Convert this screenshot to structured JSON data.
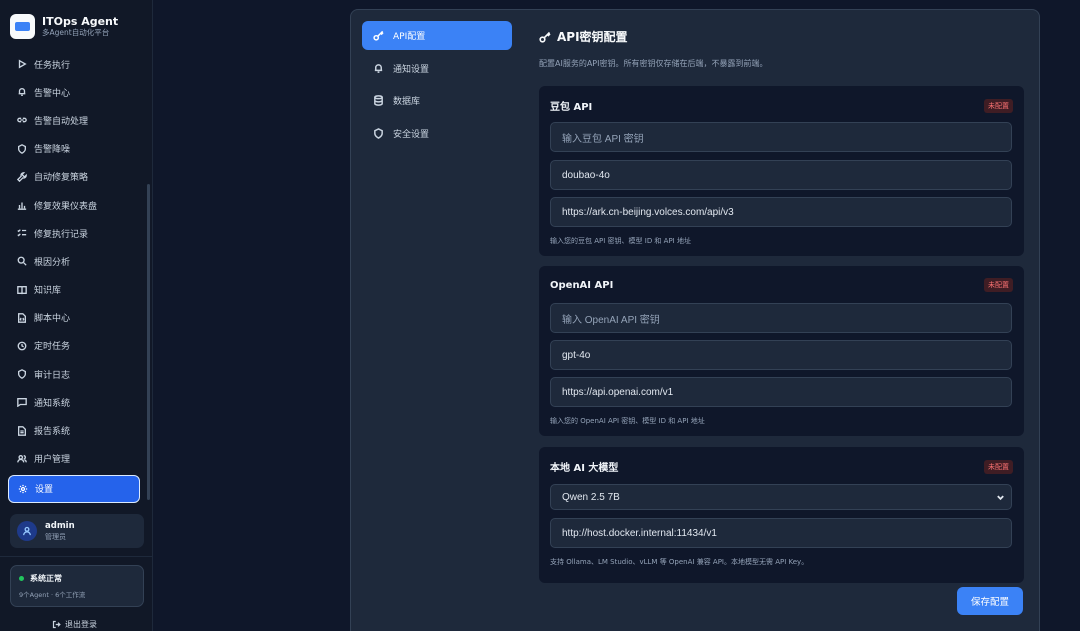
{
  "brand": {
    "name": "ITOps Agent",
    "subtitle": "多Agent自动化平台"
  },
  "sidebar": {
    "items": [
      {
        "label": "任务执行",
        "icon": "play-icon"
      },
      {
        "label": "告警中心",
        "icon": "bell-icon"
      },
      {
        "label": "告警自动处理",
        "icon": "link-icon"
      },
      {
        "label": "告警降噪",
        "icon": "shield-icon"
      },
      {
        "label": "自动修复策略",
        "icon": "wrench-icon"
      },
      {
        "label": "修复效果仪表盘",
        "icon": "bar-chart-icon"
      },
      {
        "label": "修复执行记录",
        "icon": "list-check-icon"
      },
      {
        "label": "根因分析",
        "icon": "search-icon"
      },
      {
        "label": "知识库",
        "icon": "book-icon"
      },
      {
        "label": "脚本中心",
        "icon": "file-code-icon"
      },
      {
        "label": "定时任务",
        "icon": "clock-icon"
      },
      {
        "label": "审计日志",
        "icon": "shield-icon"
      },
      {
        "label": "通知系统",
        "icon": "message-icon"
      },
      {
        "label": "报告系统",
        "icon": "file-text-icon"
      },
      {
        "label": "用户管理",
        "icon": "users-icon"
      },
      {
        "label": "设置",
        "icon": "gear-icon",
        "active": true
      }
    ]
  },
  "user": {
    "name": "admin",
    "role": "管理员"
  },
  "status": {
    "title": "系统正常",
    "detail": "9个Agent · 6个工作流"
  },
  "logout_label": "退出登录",
  "settings_nav": {
    "items": [
      {
        "label": "API配置",
        "icon": "key-icon",
        "active": true
      },
      {
        "label": "通知设置",
        "icon": "bell-icon"
      },
      {
        "label": "数据库",
        "icon": "database-icon"
      },
      {
        "label": "安全设置",
        "icon": "shield-icon"
      }
    ]
  },
  "content": {
    "title": "API密钥配置",
    "description": "配置AI服务的API密钥。所有密钥仅存储在后端，不暴露到前端。"
  },
  "providers": [
    {
      "name": "豆包 API",
      "badge": "未配置",
      "key_placeholder": "输入豆包 API 密钥",
      "model": "doubao-4o",
      "url": "https://ark.cn-beijing.volces.com/api/v3",
      "help": "输入您的豆包 API 密钥、模型 ID 和 API 地址"
    },
    {
      "name": "OpenAI API",
      "badge": "未配置",
      "key_placeholder": "输入 OpenAI API 密钥",
      "model": "gpt-4o",
      "url": "https://api.openai.com/v1",
      "help": "输入您的 OpenAI API 密钥、模型 ID 和 API 地址"
    },
    {
      "name": "本地 AI 大模型",
      "badge": "未配置",
      "model_selected": "Qwen 2.5 7B",
      "url": "http://host.docker.internal:11434/v1",
      "help": "支持 Ollama、LM Studio、vLLM 等 OpenAI 兼容 API。本地模型无需 API Key。"
    }
  ],
  "save_label": "保存配置",
  "colors": {
    "accent": "#3b82f6",
    "active_nav": "#2563eb",
    "danger": "#f87171",
    "success": "#22c55e"
  }
}
